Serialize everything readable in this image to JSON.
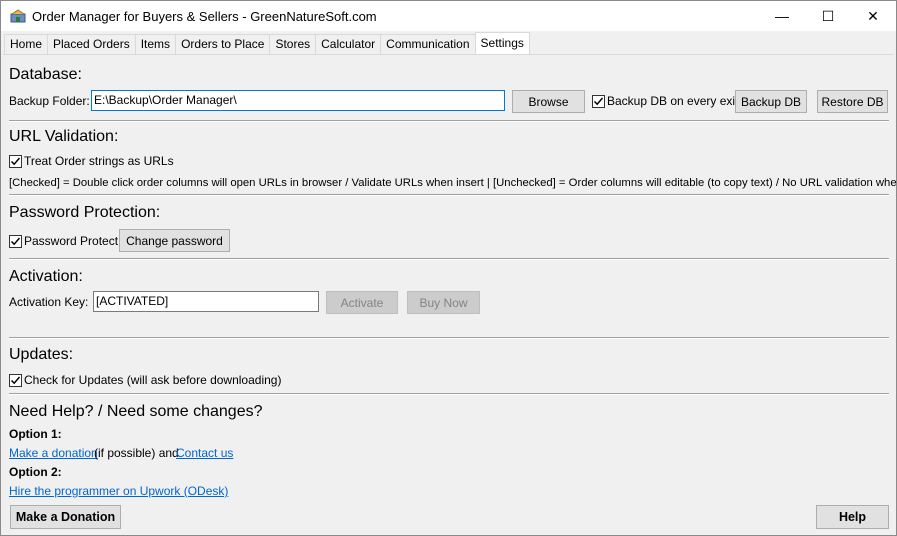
{
  "window": {
    "title": "Order Manager for Buyers & Sellers - GreenNatureSoft.com",
    "minimize": "—",
    "maximize": "☐",
    "close": "✕"
  },
  "tabs": [
    {
      "label": "Home"
    },
    {
      "label": "Placed Orders"
    },
    {
      "label": "Items"
    },
    {
      "label": "Orders to Place"
    },
    {
      "label": "Stores"
    },
    {
      "label": "Calculator"
    },
    {
      "label": "Communication"
    },
    {
      "label": "Settings",
      "active": true
    }
  ],
  "database": {
    "title": "Database:",
    "backup_folder_label": "Backup Folder:",
    "backup_folder_value": "E:\\Backup\\Order Manager\\",
    "browse": "Browse",
    "backup_on_exit": "Backup DB on every exit",
    "backup_on_exit_checked": true,
    "backup_db": "Backup DB",
    "restore_db": "Restore DB"
  },
  "url_validation": {
    "title": "URL Validation:",
    "treat_as_urls": "Treat Order strings as URLs",
    "treat_as_urls_checked": true,
    "description": "[Checked] = Double click order columns will open URLs in browser / Validate URLs when insert | [Unchecked] = Order columns will editable (to copy text) / No URL validation when insert"
  },
  "password": {
    "title": "Password Protection:",
    "protect": "Password Protect",
    "protect_checked": true,
    "change": "Change password"
  },
  "activation": {
    "title": "Activation:",
    "key_label": "Activation Key:",
    "key_value": "[ACTIVATED]",
    "activate": "Activate",
    "buy_now": "Buy Now"
  },
  "updates": {
    "title": "Updates:",
    "check": "Check for Updates (will ask before downloading)",
    "check_checked": true
  },
  "help": {
    "title": "Need Help? / Need some changes?",
    "option1": "Option 1:",
    "donation_link": "Make a donation",
    "if_possible": "(if possible) and",
    "contact_link": "Contact us",
    "option2": "Option 2:",
    "hire_link": "Hire the programmer on Upwork (ODesk)",
    "make_donation_button": "Make a Donation",
    "help_button": "Help"
  }
}
